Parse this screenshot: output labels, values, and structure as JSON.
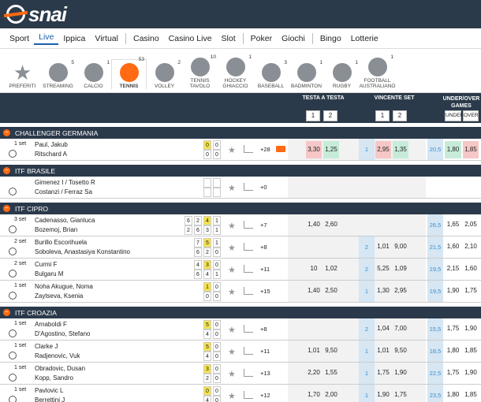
{
  "brand": {
    "logo": "snai"
  },
  "nav": [
    "Sport",
    "Live",
    "Ippica",
    "Virtual",
    "Casino",
    "Casino Live",
    "Slot",
    "Poker",
    "Giochi",
    "Bingo",
    "Lotterie"
  ],
  "sports": [
    {
      "label": "PREFERITI",
      "count": ""
    },
    {
      "label": "STREAMING",
      "count": "5"
    },
    {
      "label": "CALCIO",
      "count": "1"
    },
    {
      "label": "TENNIS",
      "count": "53"
    },
    {
      "label": "VOLLEY",
      "count": "2"
    },
    {
      "label": "TENNIS TAVOLO",
      "count": "10"
    },
    {
      "label": "HOCKEY GHIACCIO",
      "count": "1"
    },
    {
      "label": "BASEBALL",
      "count": "3"
    },
    {
      "label": "BADMINTON",
      "count": "1"
    },
    {
      "label": "RUGBY",
      "count": "1"
    },
    {
      "label": "FOOTBALL AUSTRALIANO",
      "count": "1"
    }
  ],
  "header": {
    "h2h": "TESTA A TESTA",
    "winner": "VINCENTE SET",
    "uo": "UNDER/OVER GAMES",
    "one": "1",
    "two": "2",
    "under": "UNDER",
    "over": "OVER"
  },
  "leagues": [
    {
      "name": "CHALLENGER GERMANIA",
      "matches": [
        {
          "set": "1 set",
          "p1": "Paul, Jakub",
          "p2": "Ritschard A",
          "s1": [
            "0",
            "0"
          ],
          "s2": [
            "0",
            "0"
          ],
          "more": "+28",
          "h1": "3,30",
          "h2": "1,25",
          "ws": "1",
          "w1": "2,95",
          "w2": "1,35",
          "line": "20,5",
          "u": "1,80",
          "o": "1,85"
        }
      ]
    },
    {
      "name": "ITF BRASILE",
      "matches": [
        {
          "set": "",
          "p1": "Gimenez I / Tosetto R",
          "p2": "Costanzi / Ferraz Sa",
          "s1": [
            "",
            ""
          ],
          "s2": [
            "",
            ""
          ],
          "more": "+0",
          "h1": "",
          "h2": "",
          "ws": "",
          "w1": "",
          "w2": "",
          "line": "",
          "u": "",
          "o": ""
        }
      ]
    },
    {
      "name": "ITF CIPRO",
      "matches": [
        {
          "set": "3 set",
          "p1": "Cadenasso, Gianluca",
          "p2": "Bozemoj, Brian",
          "s1": [
            "6",
            "2",
            "4",
            "1"
          ],
          "s2": [
            "2",
            "6",
            "3",
            "1"
          ],
          "more": "+7",
          "h1": "1,40",
          "h2": "2,60",
          "ws": "",
          "w1": "",
          "w2": "",
          "line": "26,5",
          "u": "1,65",
          "o": "2,05"
        },
        {
          "set": "2 set",
          "p1": "Burillo Escorihuela",
          "p2": "Soboleva, Anastasiya Konstantino",
          "s1": [
            "7",
            "5",
            "1"
          ],
          "s2": [
            "6",
            "2",
            "0"
          ],
          "more": "+8",
          "h1": "",
          "h2": "",
          "ws": "2",
          "w1": "1,01",
          "w2": "9,00",
          "line": "21,5",
          "u": "1,60",
          "o": "2,10"
        },
        {
          "set": "2 set",
          "p1": "Curmi F",
          "p2": "Bulgaru M",
          "s1": [
            "4",
            "3",
            "0"
          ],
          "s2": [
            "6",
            "4",
            "1"
          ],
          "more": "+11",
          "h1": "10",
          "h2": "1,02",
          "ws": "2",
          "w1": "5,25",
          "w2": "1,09",
          "line": "19,5",
          "u": "2,15",
          "o": "1,60"
        },
        {
          "set": "1 set",
          "p1": "Noha Akugue, Noma",
          "p2": "Zaytseva, Ksenia",
          "s1": [
            "1",
            "0"
          ],
          "s2": [
            "0",
            "0"
          ],
          "more": "+15",
          "h1": "1,40",
          "h2": "2,50",
          "ws": "1",
          "w1": "1,30",
          "w2": "2,95",
          "line": "19,5",
          "u": "1,90",
          "o": "1,75"
        }
      ]
    },
    {
      "name": "ITF CROAZIA",
      "matches": [
        {
          "set": "1 set",
          "p1": "Arnaboldi F",
          "p2": "D'Agostino, Stefano",
          "s1": [
            "5",
            "0"
          ],
          "s2": [
            "4",
            "0"
          ],
          "more": "+8",
          "h1": "",
          "h2": "",
          "ws": "2",
          "w1": "1,04",
          "w2": "7,00",
          "line": "15,5",
          "u": "1,75",
          "o": "1,90"
        },
        {
          "set": "1 set",
          "p1": "Clarke J",
          "p2": "Radjenovic, Vuk",
          "s1": [
            "5",
            "0"
          ],
          "s2": [
            "4",
            "0"
          ],
          "more": "+11",
          "h1": "1,01",
          "h2": "9,50",
          "ws": "1",
          "w1": "1,01",
          "w2": "9,50",
          "line": "18,5",
          "u": "1,80",
          "o": "1,85"
        },
        {
          "set": "1 set",
          "p1": "Obradovic, Dusan",
          "p2": "Kopp, Sandro",
          "s1": [
            "3",
            "0"
          ],
          "s2": [
            "2",
            "0"
          ],
          "more": "+13",
          "h1": "2,20",
          "h2": "1,55",
          "ws": "1",
          "w1": "1,75",
          "w2": "1,90",
          "line": "22,5",
          "u": "1,75",
          "o": "1,90"
        },
        {
          "set": "1 set",
          "p1": "Pavlovic L",
          "p2": "Berrettini J",
          "s1": [
            "0",
            "0"
          ],
          "s2": [
            "4",
            "0"
          ],
          "more": "+12",
          "h1": "1,70",
          "h2": "2,00",
          "ws": "1",
          "w1": "1,90",
          "w2": "1,75",
          "line": "23,5",
          "u": "1,80",
          "o": "1,85"
        }
      ]
    }
  ]
}
